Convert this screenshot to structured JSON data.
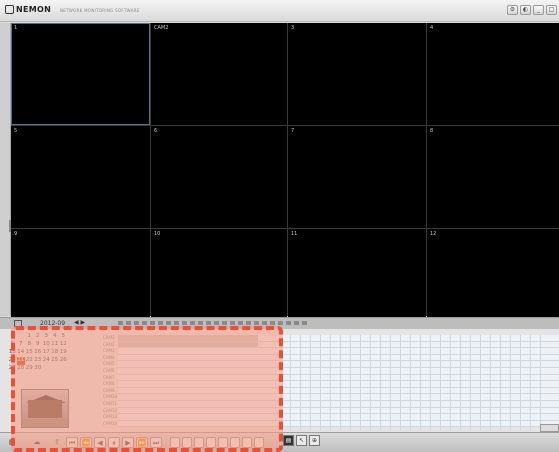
{
  "app": {
    "logo": "NEMON",
    "subtitle": "NETWORK MONITORING SOFTWARE"
  },
  "window_buttons": [
    "⚙",
    "◐",
    "_",
    "□"
  ],
  "grid": {
    "cells": [
      {
        "label": "1",
        "selected": true
      },
      {
        "label": "CAM2",
        "selected": false
      },
      {
        "label": "3",
        "selected": false
      },
      {
        "label": "4",
        "selected": false
      },
      {
        "label": "5",
        "selected": false
      },
      {
        "label": "6",
        "selected": false
      },
      {
        "label": "7",
        "selected": false
      },
      {
        "label": "8",
        "selected": false
      },
      {
        "label": "9",
        "selected": false
      },
      {
        "label": "10",
        "selected": false
      },
      {
        "label": "11",
        "selected": false
      },
      {
        "label": "12",
        "selected": false
      }
    ]
  },
  "timeline": {
    "month": "2012-09",
    "nav": "◀ ▶"
  },
  "calendar": {
    "rows": [
      [
        "",
        "",
        "1",
        "2",
        "3",
        "4",
        "5"
      ],
      [
        "6",
        "7",
        "8",
        "9",
        "10",
        "11",
        "12"
      ],
      [
        "13",
        "14",
        "15",
        "16",
        "17",
        "18",
        "19"
      ],
      [
        "20",
        "21",
        "22",
        "23",
        "24",
        "25",
        "26"
      ],
      [
        "27",
        "28",
        "29",
        "30",
        "",
        "",
        ""
      ]
    ],
    "active_day": "21"
  },
  "camera_list": [
    "CAM1",
    "CAM2",
    "CAM3",
    "CAM4",
    "CAM5",
    "CAM6",
    "CAM7",
    "CAM8",
    "CAM9",
    "CAM10",
    "CAM11",
    "CAM12",
    "CAM13",
    "CAM14"
  ],
  "toolbar": {
    "buttons": [
      "⏮",
      "⏪",
      "◀",
      "⏸",
      "▶",
      "⏩",
      "⏭"
    ]
  },
  "colors": {
    "highlight_fill": "#f8967d",
    "highlight_border": "#e8503a",
    "active_day": "#d85030"
  }
}
